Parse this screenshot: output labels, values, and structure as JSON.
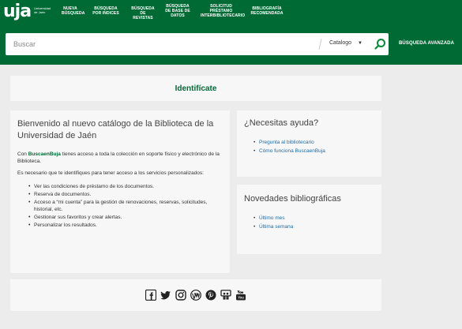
{
  "header": {
    "logo_text": "uja",
    "logo_sub": "Universidad de Jaén",
    "nav": [
      {
        "label": "NUEVA\nBÚSQUEDA"
      },
      {
        "label": "BÚSQUEDA\nPOR INDICES"
      },
      {
        "label": "BÚSQUEDA\nDE REVISTAS"
      },
      {
        "label": "BÚSQUEDA\nDE BASE DE\nDATOS"
      },
      {
        "label": "SOLICITUD\nPRÉSTAMO\nINTERBIBLIOTECARIO"
      },
      {
        "label": "BIBLIOGRAFÍA\nRECOMENDADA"
      }
    ]
  },
  "search": {
    "placeholder": "Buscar",
    "scope": "Catalogo",
    "advanced": "BÚSQUEDA AVANZADA"
  },
  "login": {
    "title": "Identifícate"
  },
  "welcome": {
    "heading": "Bienvenido al nuevo catálogo de la Biblioteca de la Universidad de Jaén",
    "p1_prefix": "Con ",
    "p1_brand": "BuscaenBuja",
    "p1_suffix": " tienes acceso a toda la colección en soporte físico y electrónico de la Biblioteca.",
    "p2": "Es necesario que te identifiques para tener acceso a los servicios personalizados:",
    "items": [
      "Ver las condiciones de préstamo de los documentos.",
      "Reserva de documentos.",
      "Acceso a “mi cuenta” para la gestión de renovaciones, reservas, solicitudes, historial, etc.",
      "Gestionar sus favoritos y crear alertas.",
      "Personalizar los resultados."
    ]
  },
  "help": {
    "title": "¿Necesitas ayuda?",
    "links": [
      "Pregunta al bibliotecario",
      "Cómo funciona BuscaenBuja"
    ]
  },
  "news": {
    "title": "Novedades bibliográficas",
    "links": [
      "Último mes",
      "Última semana"
    ]
  },
  "social": {
    "icons": [
      "facebook-icon",
      "twitter-icon",
      "instagram-icon",
      "wordpress-icon",
      "pinterest-icon",
      "slideshare-icon",
      "youtube-icon"
    ]
  },
  "colors": {
    "brand_green": "#006a35",
    "link_blue": "#1d6ca6",
    "card_bg": "#f7f7f7"
  }
}
